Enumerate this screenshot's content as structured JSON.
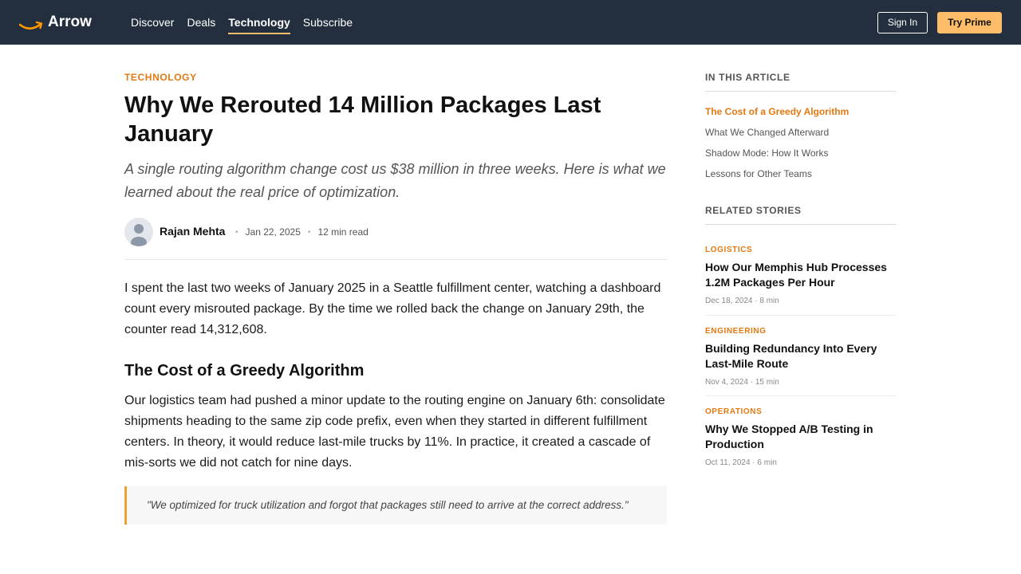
{
  "header": {
    "brand": "Arrow",
    "nav": [
      "Discover",
      "Deals",
      "Technology",
      "Subscribe"
    ],
    "active_nav": "Technology",
    "sign_in": "Sign In",
    "try_prime": "Try Prime"
  },
  "article": {
    "category": "TECHNOLOGY",
    "title": "Why We Rerouted 14 Million Packages Last January",
    "subtitle": "A single routing algorithm change cost us $38 million in three weeks. Here is what we learned about the real price of optimization.",
    "author": "Rajan Mehta",
    "date": "Jan 22, 2025",
    "read_time": "12 min read",
    "paragraph1": "I spent the last two weeks of January 2025 in a Seattle fulfillment center, watching a dashboard count every misrouted package. By the time we rolled back the change on January 29th, the counter read 14,312,608.",
    "heading": "The Cost of a Greedy Algorithm",
    "paragraph2": "Our logistics team had pushed a minor update to the routing engine on January 6th: consolidate shipments heading to the same zip code prefix, even when they started in different fulfillment centers. In theory, it would reduce last-mile trucks by 11%. In practice, it created a cascade of mis-sorts we did not catch for nine days.",
    "quote": "\"We optimized for truck utilization and forgot that packages still need to arrive at the correct address.\""
  },
  "sidebar": {
    "toc_heading": "IN THIS ARTICLE",
    "toc": [
      "The Cost of a Greedy Algorithm",
      "What We Changed Afterward",
      "Shadow Mode: How It Works",
      "Lessons for Other Teams"
    ],
    "related_heading": "RELATED STORIES",
    "related": [
      {
        "category": "LOGISTICS",
        "title": "How Our Memphis Hub Processes 1.2M Packages Per Hour",
        "meta": "Dec 18, 2024 · 8 min"
      },
      {
        "category": "ENGINEERING",
        "title": "Building Redundancy Into Every Last-Mile Route",
        "meta": "Nov 4, 2024 · 15 min"
      },
      {
        "category": "OPERATIONS",
        "title": "Why We Stopped A/B Testing in Production",
        "meta": "Oct 11, 2024 · 6 min"
      }
    ]
  },
  "colors": {
    "nav_bg": "#232f3e",
    "accent": "#e47911",
    "prime": "#febd69"
  }
}
